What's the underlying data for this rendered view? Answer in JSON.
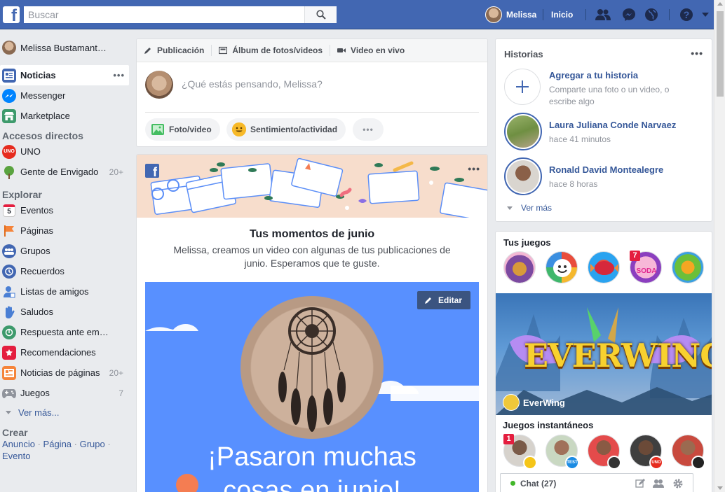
{
  "topbar": {
    "search_placeholder": "Buscar",
    "user_name": "Melissa",
    "home_label": "Inicio"
  },
  "leftnav": {
    "profile_name": "Melissa Bustamant…",
    "main_items": [
      {
        "label": "Noticias",
        "icon": "news-feed-icon"
      },
      {
        "label": "Messenger",
        "icon": "messenger-icon"
      },
      {
        "label": "Marketplace",
        "icon": "marketplace-icon"
      }
    ],
    "shortcuts_header": "Accesos directos",
    "shortcuts": [
      {
        "label": "UNO",
        "count": ""
      },
      {
        "label": "Gente de Envigado",
        "count": "20+"
      }
    ],
    "explore_header": "Explorar",
    "explore": [
      {
        "label": "Eventos",
        "count": ""
      },
      {
        "label": "Páginas",
        "count": ""
      },
      {
        "label": "Grupos",
        "count": ""
      },
      {
        "label": "Recuerdos",
        "count": ""
      },
      {
        "label": "Listas de amigos",
        "count": ""
      },
      {
        "label": "Saludos",
        "count": ""
      },
      {
        "label": "Respuesta ante em…",
        "count": ""
      },
      {
        "label": "Recomendaciones",
        "count": ""
      },
      {
        "label": "Noticias de páginas",
        "count": "20+"
      },
      {
        "label": "Juegos",
        "count": "7"
      }
    ],
    "see_more": "Ver más...",
    "create_header": "Crear",
    "create_links": [
      "Anuncio",
      "Página",
      "Grupo",
      "Evento"
    ],
    "events_icon_number": "5"
  },
  "composer": {
    "tabs": [
      "Publicación",
      "Álbum de fotos/videos",
      "Video en vivo"
    ],
    "placeholder": "¿Qué estás pensando, Melissa?",
    "buttons": [
      "Foto/video",
      "Sentimiento/actividad"
    ]
  },
  "memories": {
    "title": "Tus momentos de junio",
    "description": "Melissa, creamos un video con algunas de tus publicaciones de junio. Esperamos que te guste.",
    "edit_label": "Editar",
    "video_text_line1": "¡Pasaron muchas",
    "video_text_line2": "cosas en junio!"
  },
  "stories": {
    "title": "Historias",
    "add_title": "Agregar a tu historia",
    "add_sub": "Comparte una foto o un video, o escribe algo",
    "items": [
      {
        "name": "Laura Juliana Conde Narvaez",
        "time": "hace 41 minutos"
      },
      {
        "name": "Ronald David Montealegre",
        "time": "hace 8 horas"
      }
    ],
    "see_more": "Ver más"
  },
  "games": {
    "title": "Tus juegos",
    "badge_count": "7",
    "featured_name": "EverWing",
    "featured_logo_text": "EVERWING",
    "instant_title": "Juegos instantáneos",
    "instant_badge": "1",
    "candy_icon_text": "SODA",
    "uno_icon_text": "UNO",
    "test_badge": "TEST"
  },
  "chat": {
    "label": "Chat (27)"
  },
  "colors": {
    "brand": "#4267b2",
    "link": "#365899",
    "online": "#42b72a",
    "badge": "#e41e3f"
  }
}
